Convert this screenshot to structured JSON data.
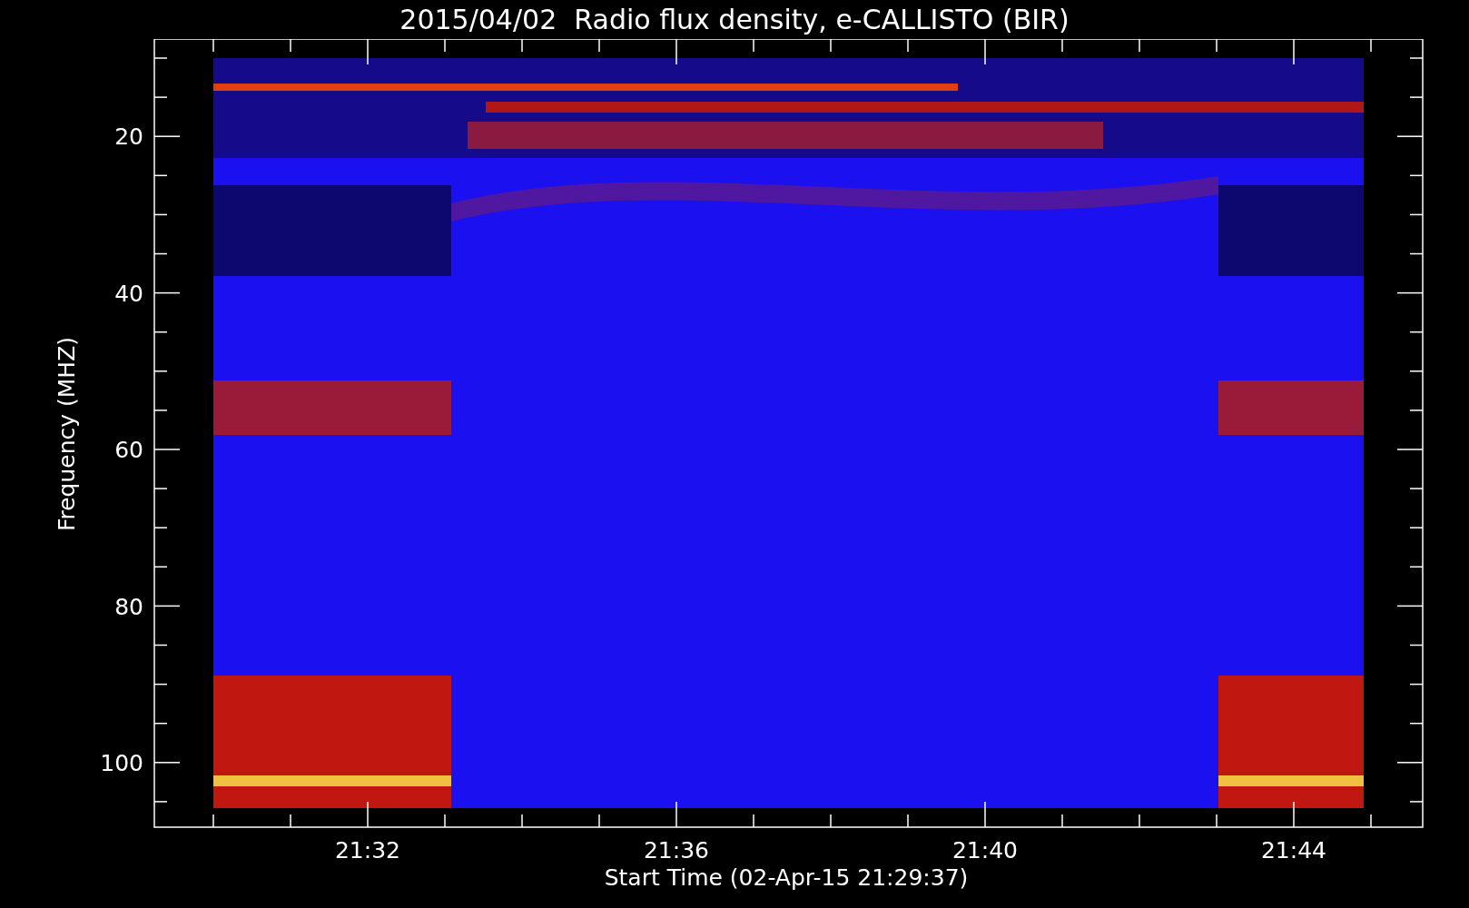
{
  "title": "2015/04/02  Radio flux density, e-CALLISTO (BIR)",
  "y_axis": {
    "label": "Frequency (MHZ)",
    "ticks": [
      "20",
      "40",
      "60",
      "80",
      "100"
    ]
  },
  "x_axis": {
    "label": "Start Time (02-Apr-15 21:29:37)",
    "ticks": [
      "21:32",
      "21:36",
      "21:40",
      "21:44"
    ]
  }
}
